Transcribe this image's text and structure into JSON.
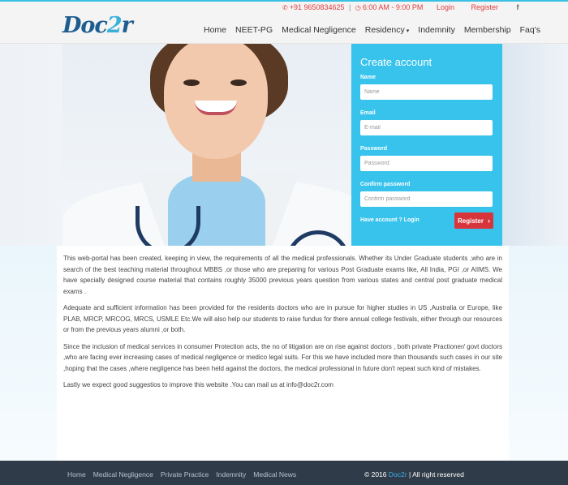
{
  "topbar": {
    "phone_icon": "phone-icon",
    "phone": "+91 9650834625",
    "clock_icon": "clock-icon",
    "hours": "6:00 AM - 9:00 PM",
    "login": "Login",
    "register": "Register",
    "facebook_icon": "facebook-icon",
    "facebook_glyph": "f"
  },
  "logo": {
    "part1": "D",
    "part2": "oc",
    "part3": "2",
    "part4": "r"
  },
  "nav": {
    "items": [
      "Home",
      "NEET-PG",
      "Medical Negligence",
      "Residency",
      "Indemnity",
      "Membership",
      "Faq's"
    ],
    "dropdown_caret": "▾"
  },
  "form": {
    "title": "Create account",
    "name_label": "Name",
    "name_placeholder": "Name",
    "email_label": "Email",
    "email_placeholder": "E-mail",
    "password_label": "Password",
    "password_placeholder": "Password",
    "confirm_label": "Confirm password",
    "confirm_placeholder": "Confirm password",
    "have_account": "Have account ? Login",
    "register_button": "Register",
    "register_arrow": "›"
  },
  "content": {
    "paragraphs": [
      "This web-portal has been created, keeping in view, the requirements of all the medical professionals. Whether its Under Graduate students ,who are in search of the best teaching material throughout MBBS ,or those who are preparing for various Post Graduate exams like, All India, PGI ,or AIIMS. We have specially designed course material that contains roughly 35000 previous years question from various states and central post graduate medical exams .",
      "Adequate and sufficient information has been provided for the residents doctors who are in pursue for higher studies in US ,Australia or Europe, like PLAB, MRCP, MRCOG, MRCS, USMLE Etc.We will also help our students to raise fundus for there annual college festivals, either through our resources or from the previous years alumni ,or both.",
      "Since the inclusion of medical services in consumer Protection acts, the no of litigation are on rise against doctors , both private Practioner/ govt doctors ,who are facing ever increasing cases of medical negligence or medico legal suits. For this we have included more than thousands such cases in our site ,hoping that the cases ,where negligence has been held against the doctors, the medical professional in future don't repeat such kind of mistakes.",
      "Lastly we expect good suggestios to improve this website .You can mail us at info@doc2r.com"
    ]
  },
  "footer": {
    "links": [
      "Home",
      "Medical Negligence",
      "Private Practice",
      "Indemnity",
      "Medical News"
    ],
    "copyright_prefix": "© 2016",
    "brand": "Doc2r",
    "copyright_suffix": "| All right reserved"
  },
  "colors": {
    "accent": "#38c3ec",
    "register_button": "#d7343b",
    "footer_bg": "#2f3b48",
    "topbar_text": "#e03c3c"
  }
}
